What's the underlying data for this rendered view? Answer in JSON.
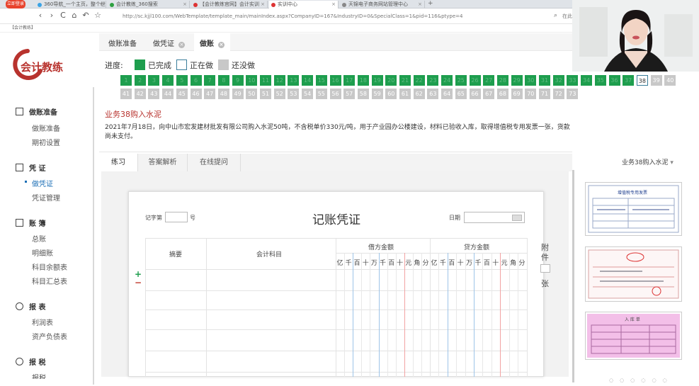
{
  "browser": {
    "badge": "立即登录",
    "tabs": [
      {
        "title": "360导航_一个主页，整个世界",
        "color": "#3aa3e5"
      },
      {
        "title": "会计教练_360搜索",
        "color": "#2ea040"
      },
      {
        "title": "【会计教练官网】会计实训",
        "color": "#d33"
      },
      {
        "title": "实训中心",
        "color": "#d33"
      },
      {
        "title": "天锦电子商务网站管理中心",
        "color": "#888"
      }
    ],
    "new_tab": "+",
    "url": "http://sc.kjjl100.com/WebTemplate/template_main/mainIndex.aspx?CompanyID=167&IndustryID=0&SpecialClass=1&pid=116&ptype=4",
    "bookmark": "【会计教练】",
    "nav": {
      "back": "‹",
      "forward": "›",
      "refresh": "C",
      "home": "⌂",
      "undo": "↶",
      "star": "☆"
    },
    "search_placeholder": "在此"
  },
  "brand": {
    "logo_text": "会计教练",
    "color": "#b8332e"
  },
  "sidebar": {
    "sections": [
      {
        "title": "做账准备",
        "items": [
          "做账准备",
          "期初设置"
        ]
      },
      {
        "title": "凭 证",
        "items": [
          "做凭证",
          "凭证管理"
        ]
      },
      {
        "title": "账 簿",
        "items": [
          "总账",
          "明细账",
          "科目余额表",
          "科目汇总表"
        ]
      },
      {
        "title": "报 表",
        "items": [
          "利润表",
          "资产负债表"
        ]
      },
      {
        "title": "报 税",
        "items": [
          "报税"
        ]
      }
    ]
  },
  "topnav": {
    "tabs": [
      "做账准备",
      "做凭证",
      "做账"
    ],
    "active": 2
  },
  "progress": {
    "label": "进度:",
    "legend": {
      "done": "已完成",
      "doing": "正在做",
      "todo": "还没做"
    },
    "colors": {
      "done": "#1e9e4e",
      "todo": "#c8c8c8"
    },
    "numbers": [
      "1",
      "2",
      "3",
      "4",
      "5",
      "6",
      "7",
      "8",
      "9",
      "10",
      "11",
      "12",
      "13",
      "14",
      "15",
      "16",
      "17",
      "18",
      "19",
      "20",
      "21",
      "22",
      "23",
      "24",
      "25",
      "26",
      "27",
      "28",
      "29",
      "30",
      "31",
      "32",
      "33",
      "34",
      "35",
      "36",
      "37",
      "38",
      "39",
      "40",
      "41",
      "42",
      "43",
      "44",
      "45",
      "46",
      "47",
      "48",
      "49",
      "50",
      "51",
      "52",
      "53",
      "54",
      "55",
      "56",
      "57",
      "58",
      "59",
      "60",
      "61",
      "62",
      "63",
      "64",
      "65",
      "66",
      "67",
      "68",
      "69",
      "70",
      "71",
      "72",
      "73"
    ],
    "current": 38
  },
  "business": {
    "title": "业务38购入水泥",
    "description": "2021年7月18日，向中山市宏发建材批发有限公司购入水泥50吨，不含税单价330元/吨，用于产业园办公楼建设，材料已验收入库，取得增值税专用发票一张，货款尚未支付。"
  },
  "subtabs": {
    "items": [
      "练习",
      "答案解析",
      "在线提问"
    ],
    "active": 0
  },
  "biz_select": "业务38购入水泥",
  "voucher": {
    "title": "记账凭证",
    "number_prefix": "记字第",
    "number_suffix": "号",
    "date_label": "日期",
    "col_summary": "摘要",
    "col_account": "会计科目",
    "col_debit": "借方金额",
    "col_credit": "贷方金额",
    "digits": [
      "亿",
      "千",
      "百",
      "十",
      "万",
      "千",
      "百",
      "十",
      "元",
      "角",
      "分"
    ],
    "attach_top": "附",
    "attach_mid": "件",
    "attach_bottom": "张",
    "add": "+",
    "remove": "−"
  },
  "thumbs": {
    "t1_title": "增值税专用发票",
    "t3_title": "入 库 单"
  }
}
